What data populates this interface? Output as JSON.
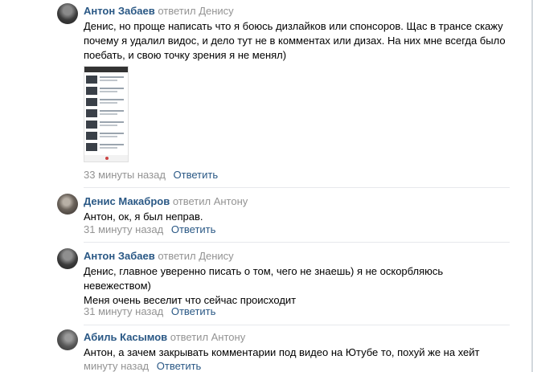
{
  "comments": [
    {
      "author": "Антон Забаев",
      "replied_to": "ответил Денису",
      "lines": [
        "Денис, но проще написать что я боюсь дизлайков или спонсоров. Щас в трансе скажу",
        "почему я удалил видос, и дело тут не в комментах или дизах. На них мне всегда было",
        "поебать, и свою точку зрения я не менял)"
      ],
      "time": "33 минуты назад",
      "reply_label": "Ответить"
    },
    {
      "author": "Денис Макабров",
      "replied_to": "ответил Антону",
      "lines": [
        "Антон, ок, я был неправ."
      ],
      "time": "31 минуту назад",
      "reply_label": "Ответить"
    },
    {
      "author": "Антон Забаев",
      "replied_to": "ответил Денису",
      "lines": [
        "Денис, главное уверенно писать о том, чего не знаешь) я не оскорбляюсь",
        "невежеством)",
        "Меня очень веселит что сейчас происходит"
      ],
      "time": "31 минуту назад",
      "reply_label": "Ответить"
    },
    {
      "author": "Абиль Касымов",
      "replied_to": "ответил Антону",
      "lines": [
        "Антон, а зачем закрывать комментарии под видео на Ютубе то, похуй же на хейт"
      ],
      "time": "минуту назад",
      "reply_label": "Ответить"
    }
  ],
  "colors": {
    "author": "#2a5885",
    "muted": "#939393"
  }
}
